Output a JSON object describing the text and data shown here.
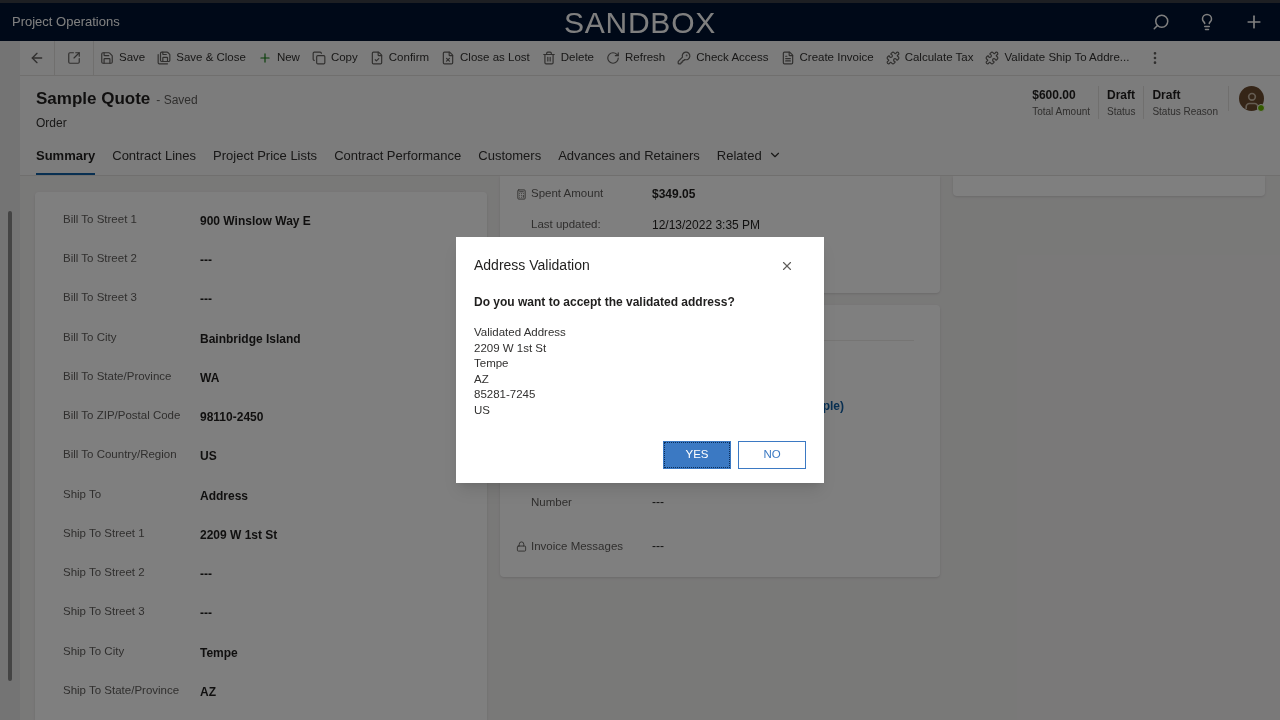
{
  "app_bar": {
    "app_name": "Project Operations",
    "environment": "SANDBOX"
  },
  "command_bar": {
    "items": [
      {
        "label": "Save"
      },
      {
        "label": "Save & Close"
      },
      {
        "label": "New"
      },
      {
        "label": "Copy"
      },
      {
        "label": "Confirm"
      },
      {
        "label": "Close as Lost"
      },
      {
        "label": "Delete"
      },
      {
        "label": "Refresh"
      },
      {
        "label": "Check Access"
      },
      {
        "label": "Create Invoice"
      },
      {
        "label": "Calculate Tax"
      },
      {
        "label": "Validate Ship To Addre..."
      }
    ]
  },
  "record": {
    "title": "Sample Quote",
    "save_state": "- Saved",
    "entity": "Order",
    "header_fields": [
      {
        "value": "$600.00",
        "label": "Total Amount"
      },
      {
        "value": "Draft",
        "label": "Status"
      },
      {
        "value": "Draft",
        "label": "Status Reason"
      }
    ],
    "user_online": true
  },
  "tabs": [
    {
      "label": "Summary",
      "selected": true
    },
    {
      "label": "Contract Lines",
      "selected": false
    },
    {
      "label": "Project Price Lists",
      "selected": false
    },
    {
      "label": "Contract Performance",
      "selected": false
    },
    {
      "label": "Customers",
      "selected": false
    },
    {
      "label": "Advances and Retainers",
      "selected": false
    },
    {
      "label": "Related",
      "selected": false
    }
  ],
  "address_fields": [
    {
      "label": "Bill To Street 1",
      "value": "900 Winslow Way E"
    },
    {
      "label": "Bill To Street 2",
      "value": "---"
    },
    {
      "label": "Bill To Street 3",
      "value": "---"
    },
    {
      "label": "Bill To City",
      "value": "Bainbridge Island"
    },
    {
      "label": "Bill To State/Province",
      "value": "WA"
    },
    {
      "label": "Bill To ZIP/Postal Code",
      "value": "98110-2450"
    },
    {
      "label": "Bill To Country/Region",
      "value": "US"
    },
    {
      "label": "Ship To",
      "value": "Address"
    },
    {
      "label": "Ship To Street 1",
      "value": "2209 W 1st St"
    },
    {
      "label": "Ship To Street 2",
      "value": "---"
    },
    {
      "label": "Ship To Street 3",
      "value": "---"
    },
    {
      "label": "Ship To City",
      "value": "Tempe"
    },
    {
      "label": "Ship To State/Province",
      "value": "AZ"
    }
  ],
  "performance_card": {
    "fields": [
      {
        "label": "Spent Amount",
        "value": "$349.05",
        "kind": "calculated"
      },
      {
        "label": "Last updated:",
        "value": "12/13/2022 3:35 PM",
        "kind": "plain"
      }
    ]
  },
  "invoice_card": {
    "link_fragment": "ple)",
    "fields": [
      {
        "label": "Number",
        "value": "---",
        "kind": "plain"
      },
      {
        "label": "Invoice Messages",
        "value": "---",
        "kind": "locked"
      }
    ]
  },
  "dialog": {
    "title": "Address Validation",
    "question": "Do you want to accept the validated address?",
    "lines": [
      "Validated Address",
      "2209 W 1st St",
      "Tempe",
      "AZ",
      "85281-7245",
      "US"
    ],
    "buttons": [
      {
        "label": "YES",
        "primary": true
      },
      {
        "label": "NO",
        "primary": false
      }
    ]
  }
}
